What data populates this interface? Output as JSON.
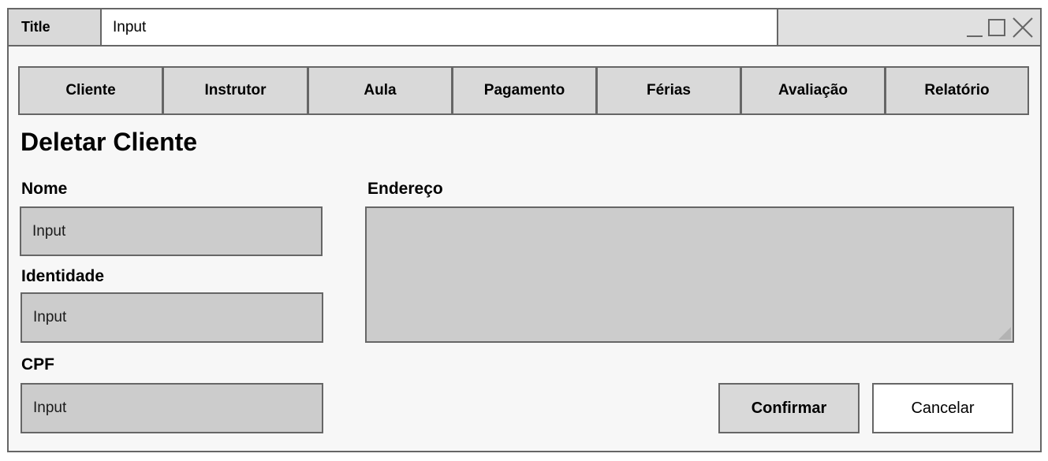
{
  "window": {
    "title_label": "Title",
    "title_input_value": "Input",
    "controls": {
      "minimize_icon": "minimize-icon",
      "maximize_icon": "maximize-icon",
      "close_icon": "close-icon"
    }
  },
  "tabs": [
    {
      "label": "Cliente"
    },
    {
      "label": "Instrutor"
    },
    {
      "label": "Aula"
    },
    {
      "label": "Pagamento"
    },
    {
      "label": "Férias"
    },
    {
      "label": "Avaliação"
    },
    {
      "label": "Relatório"
    }
  ],
  "page": {
    "title": "Deletar Cliente"
  },
  "form": {
    "nome": {
      "label": "Nome",
      "value": "Input"
    },
    "identidade": {
      "label": "Identidade",
      "value": "Input"
    },
    "cpf": {
      "label": "CPF",
      "value": "Input"
    },
    "endereco": {
      "label": "Endereço",
      "value": ""
    }
  },
  "actions": {
    "confirm_label": "Confirmar",
    "cancel_label": "Cancelar"
  },
  "colors": {
    "border": "#666666",
    "input_bg": "#cccccc",
    "tab_bg": "#d9d9d9",
    "window_bg": "#f7f7f7"
  }
}
